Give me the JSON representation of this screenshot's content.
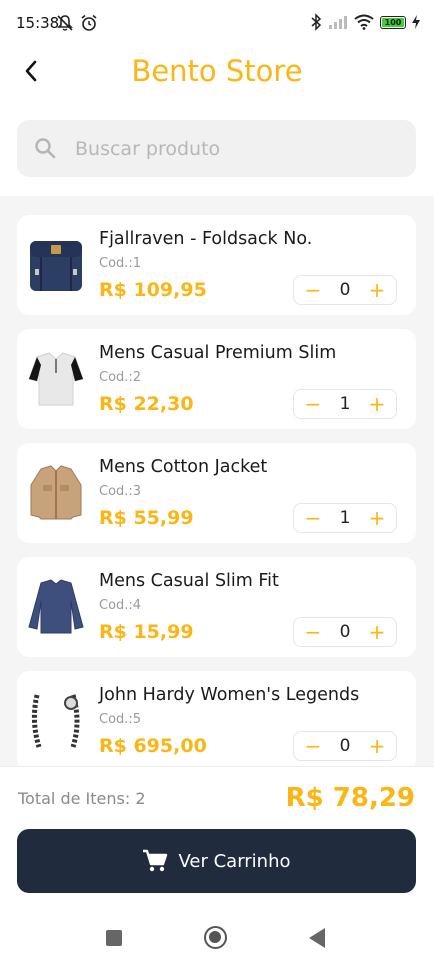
{
  "status_bar": {
    "time": "15:38",
    "battery": "100"
  },
  "app_bar": {
    "title": "Bento Store"
  },
  "search": {
    "placeholder": "Buscar produto"
  },
  "products": [
    {
      "name": "Fjallraven - Foldsack No.",
      "code": "Cod.:1",
      "price": "R$ 109,95",
      "qty": "0",
      "image": "backpack"
    },
    {
      "name": "Mens Casual Premium Slim",
      "code": "Cod.:2",
      "price": "R$ 22,30",
      "qty": "1",
      "image": "tshirt"
    },
    {
      "name": "Mens Cotton Jacket",
      "code": "Cod.:3",
      "price": "R$ 55,99",
      "qty": "1",
      "image": "jacket"
    },
    {
      "name": "Mens Casual Slim Fit",
      "code": "Cod.:4",
      "price": "R$ 15,99",
      "qty": "0",
      "image": "longsleeve"
    },
    {
      "name": "John Hardy Women's Legends",
      "code": "Cod.:5",
      "price": "R$ 695,00",
      "qty": "0",
      "image": "bracelet"
    }
  ],
  "stepper": {
    "minus": "−",
    "plus": "+"
  },
  "footer": {
    "total_items_label": "Total de Itens: 2",
    "total_value": "R$ 78,29",
    "cart_button_label": "Ver Carrinho"
  },
  "colors": {
    "accent": "#fbb615",
    "button_bg": "#212b3e"
  }
}
